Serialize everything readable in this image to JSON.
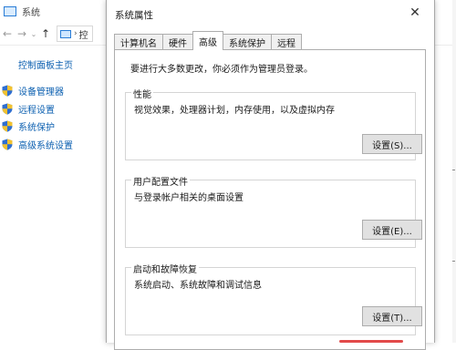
{
  "background_window": {
    "title": "系统",
    "address_fragment": "控",
    "sidebar": {
      "home_link": "控制面板主页",
      "items": [
        {
          "label": "设备管理器",
          "icon": "shield-icon"
        },
        {
          "label": "远程设置",
          "icon": "shield-icon"
        },
        {
          "label": "系统保护",
          "icon": "shield-icon"
        },
        {
          "label": "高级系统设置",
          "icon": "shield-icon"
        }
      ]
    },
    "right_edge_text": "​"
  },
  "dialog": {
    "title": "系统属性",
    "tabs": [
      {
        "label": "计算机名",
        "active": false
      },
      {
        "label": "硬件",
        "active": false
      },
      {
        "label": "高级",
        "active": true
      },
      {
        "label": "系统保护",
        "active": false
      },
      {
        "label": "远程",
        "active": false
      }
    ],
    "admin_note": "要进行大多数更改，你必须作为管理员登录。",
    "groups": {
      "performance": {
        "title": "性能",
        "description": "视觉效果，处理器计划，内存使用，以及虚拟内存",
        "button": "设置(S)..."
      },
      "user_profiles": {
        "title": "用户配置文件",
        "description": "与登录帐户相关的桌面设置",
        "button": "设置(E)..."
      },
      "startup_recovery": {
        "title": "启动和故障恢复",
        "description": "系统启动、系统故障和调试信息",
        "button": "设置(T)..."
      }
    }
  },
  "colors": {
    "link_blue": "#0b5fb0",
    "button_face": "#e1e1e1",
    "border": "#adadad"
  }
}
